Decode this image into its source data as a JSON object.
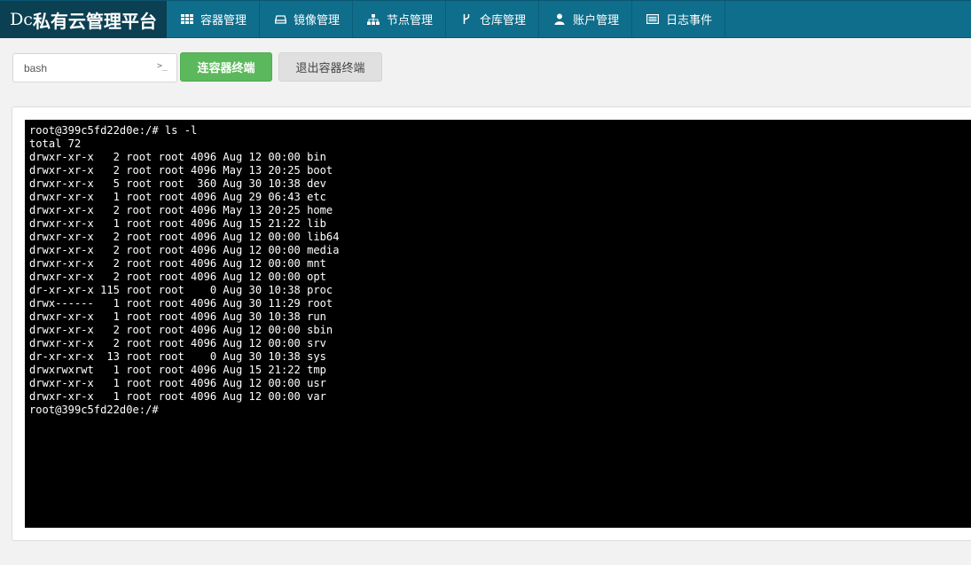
{
  "brand": {
    "prefix": "Dc",
    "title": "私有云管理平台"
  },
  "nav": [
    {
      "label": "容器管理",
      "icon": "grid-icon"
    },
    {
      "label": "镜像管理",
      "icon": "hdd-icon"
    },
    {
      "label": "节点管理",
      "icon": "sitemap-icon"
    },
    {
      "label": "仓库管理",
      "icon": "fork-icon"
    },
    {
      "label": "账户管理",
      "icon": "user-icon"
    },
    {
      "label": "日志事件",
      "icon": "list-icon"
    }
  ],
  "toolbar": {
    "command_value": "bash",
    "prompt_glyph": ">_",
    "connect_label": "连容器终端",
    "exit_label": "退出容器终端"
  },
  "terminal": {
    "lines": [
      "root@399c5fd22d0e:/# ls -l",
      "total 72",
      "drwxr-xr-x   2 root root 4096 Aug 12 00:00 bin",
      "drwxr-xr-x   2 root root 4096 May 13 20:25 boot",
      "drwxr-xr-x   5 root root  360 Aug 30 10:38 dev",
      "drwxr-xr-x   1 root root 4096 Aug 29 06:43 etc",
      "drwxr-xr-x   2 root root 4096 May 13 20:25 home",
      "drwxr-xr-x   1 root root 4096 Aug 15 21:22 lib",
      "drwxr-xr-x   2 root root 4096 Aug 12 00:00 lib64",
      "drwxr-xr-x   2 root root 4096 Aug 12 00:00 media",
      "drwxr-xr-x   2 root root 4096 Aug 12 00:00 mnt",
      "drwxr-xr-x   2 root root 4096 Aug 12 00:00 opt",
      "dr-xr-xr-x 115 root root    0 Aug 30 10:38 proc",
      "drwx------   1 root root 4096 Aug 30 11:29 root",
      "drwxr-xr-x   1 root root 4096 Aug 30 10:38 run",
      "drwxr-xr-x   2 root root 4096 Aug 12 00:00 sbin",
      "drwxr-xr-x   2 root root 4096 Aug 12 00:00 srv",
      "dr-xr-xr-x  13 root root    0 Aug 30 10:38 sys",
      "drwxrwxrwt   1 root root 4096 Aug 15 21:22 tmp",
      "drwxr-xr-x   1 root root 4096 Aug 12 00:00 usr",
      "drwxr-xr-x   1 root root 4096 Aug 12 00:00 var",
      "root@399c5fd22d0e:/#"
    ]
  }
}
